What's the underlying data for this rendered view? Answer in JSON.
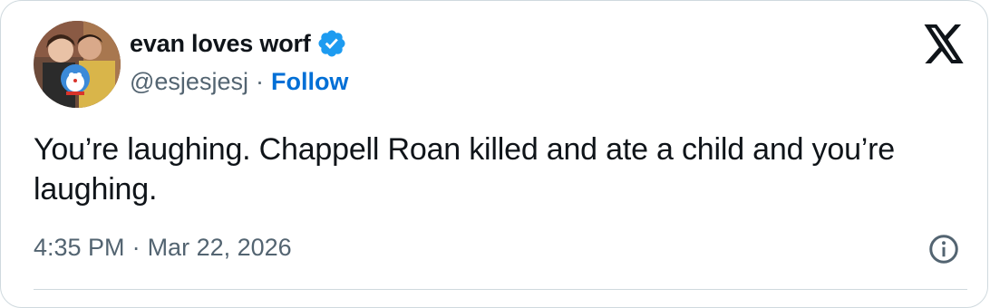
{
  "author": {
    "display_name": "evan loves worf",
    "handle": "@esjesjesj",
    "separator": "·",
    "follow_label": "Follow",
    "verified_icon": "verified-badge-icon",
    "verified_color": "#1d9bf0"
  },
  "tweet": {
    "text": "You’re laughing. Chappell Roan killed and ate a child and you’re laughing.",
    "time": "4:35 PM",
    "separator": "·",
    "date": "Mar 22, 2026"
  },
  "icons": {
    "platform": "x-logo-icon",
    "info": "info-icon"
  },
  "colors": {
    "text": "#0f1419",
    "secondary": "#536471",
    "link": "#006fd6",
    "border": "#cfd9de"
  }
}
